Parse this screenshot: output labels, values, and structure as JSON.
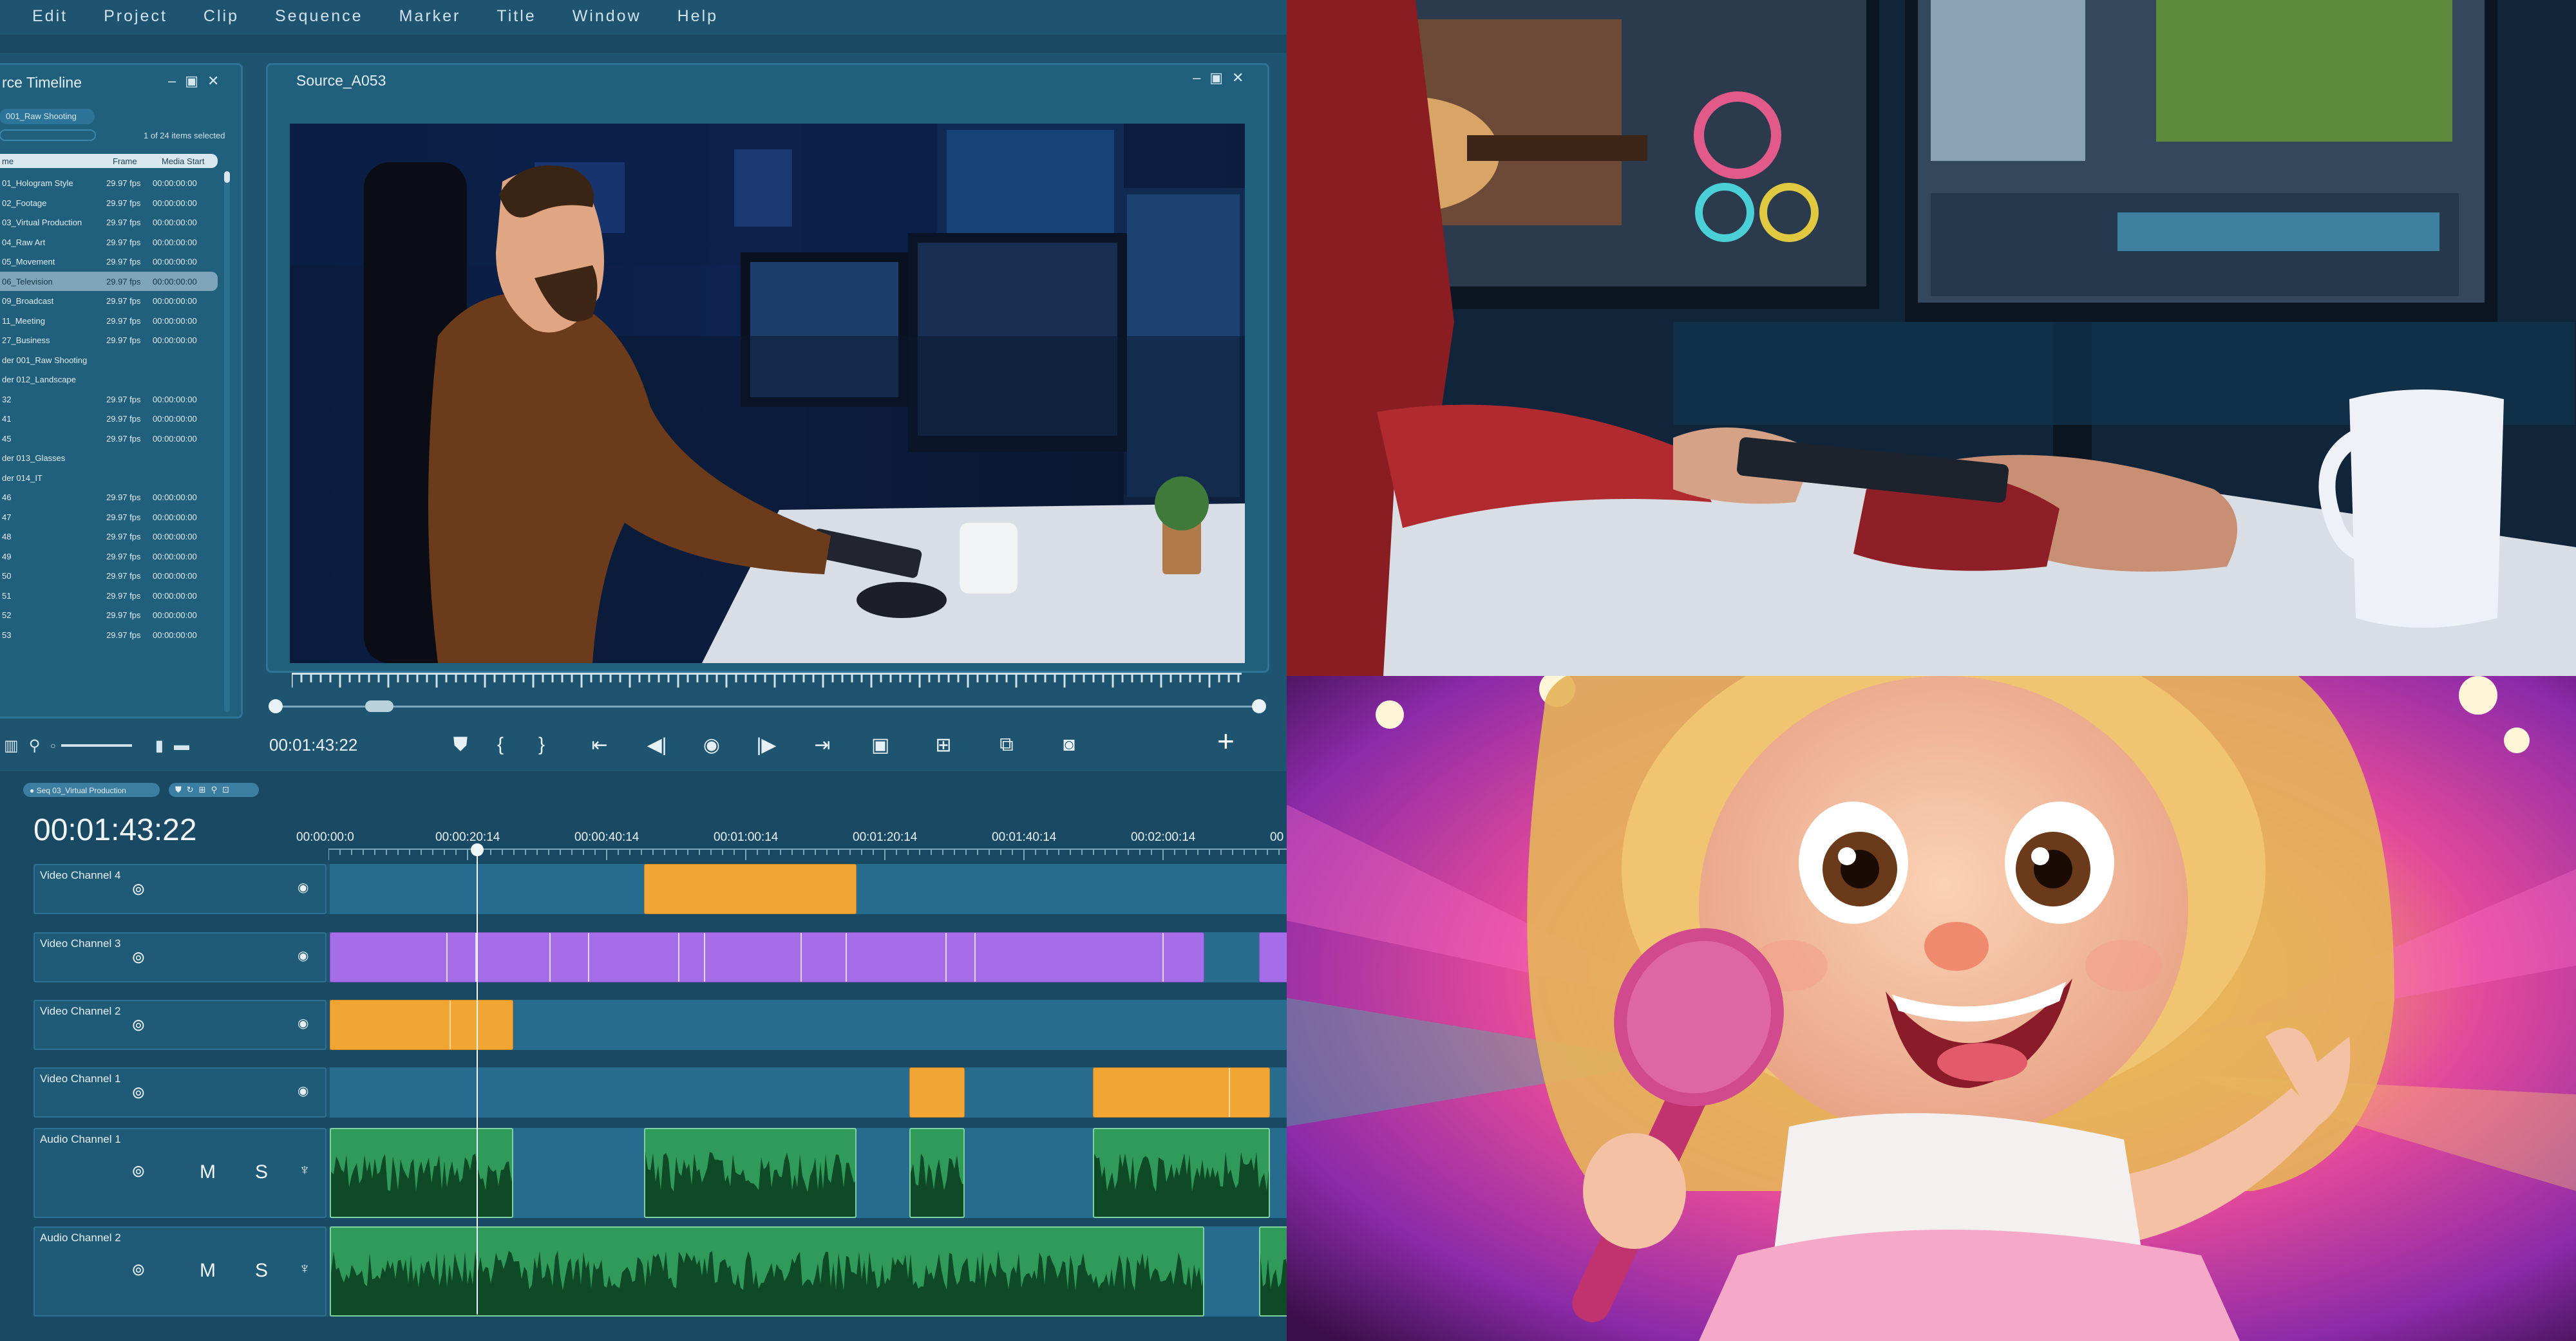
{
  "menu": [
    "Edit",
    "Project",
    "Clip",
    "Sequence",
    "Marker",
    "Title",
    "Window",
    "Help"
  ],
  "source_panel": {
    "title": "rce Timeline",
    "bin": "001_Raw Shooting",
    "selection": "1 of 24 items selected",
    "headers": {
      "name": "me",
      "frame": "Frame",
      "start": "Media Start"
    },
    "rows": [
      {
        "name": "01_Hologram Style",
        "fps": "29.97 fps",
        "start": "00:00:00:00",
        "sel": false
      },
      {
        "name": "02_Footage",
        "fps": "29.97 fps",
        "start": "00:00:00:00",
        "sel": false
      },
      {
        "name": "03_Virtual Production",
        "fps": "29.97 fps",
        "start": "00:00:00:00",
        "sel": false
      },
      {
        "name": "04_Raw Art",
        "fps": "29.97 fps",
        "start": "00:00:00:00",
        "sel": false
      },
      {
        "name": "05_Movement",
        "fps": "29.97 fps",
        "start": "00:00:00:00",
        "sel": false
      },
      {
        "name": "06_Television",
        "fps": "29.97 fps",
        "start": "00:00:00:00",
        "sel": true
      },
      {
        "name": "09_Broadcast",
        "fps": "29.97 fps",
        "start": "00:00:00:00",
        "sel": false
      },
      {
        "name": "11_Meeting",
        "fps": "29.97 fps",
        "start": "00:00:00:00",
        "sel": false
      },
      {
        "name": "27_Business",
        "fps": "29.97 fps",
        "start": "00:00:00:00",
        "sel": false
      },
      {
        "name": "der 001_Raw Shooting",
        "fps": "",
        "start": "",
        "sel": false
      },
      {
        "name": "der 012_Landscape",
        "fps": "",
        "start": "",
        "sel": false
      },
      {
        "name": "32",
        "fps": "29.97 fps",
        "start": "00:00:00:00",
        "sel": false
      },
      {
        "name": "41",
        "fps": "29.97 fps",
        "start": "00:00:00:00",
        "sel": false
      },
      {
        "name": "45",
        "fps": "29.97 fps",
        "start": "00:00:00:00",
        "sel": false
      },
      {
        "name": "der 013_Glasses",
        "fps": "",
        "start": "",
        "sel": false
      },
      {
        "name": "der 014_IT",
        "fps": "",
        "start": "",
        "sel": false
      },
      {
        "name": "46",
        "fps": "29.97 fps",
        "start": "00:00:00:00",
        "sel": false
      },
      {
        "name": "47",
        "fps": "29.97 fps",
        "start": "00:00:00:00",
        "sel": false
      },
      {
        "name": "48",
        "fps": "29.97 fps",
        "start": "00:00:00:00",
        "sel": false
      },
      {
        "name": "49",
        "fps": "29.97 fps",
        "start": "00:00:00:00",
        "sel": false
      },
      {
        "name": "50",
        "fps": "29.97 fps",
        "start": "00:00:00:00",
        "sel": false
      },
      {
        "name": "51",
        "fps": "29.97 fps",
        "start": "00:00:00:00",
        "sel": false
      },
      {
        "name": "52",
        "fps": "29.97 fps",
        "start": "00:00:00:00",
        "sel": false
      },
      {
        "name": "53",
        "fps": "29.97 fps",
        "start": "00:00:00:00",
        "sel": false
      }
    ]
  },
  "monitor": {
    "title": "Source_A053",
    "timecode": "00:01:43:22"
  },
  "timeline": {
    "sequence": "Seq 03_Virtual Production",
    "timecode": "00:01:43:22",
    "ruler": [
      "00:00:00:0",
      "00:00:20:14",
      "00:00:40:14",
      "00:01:00:14",
      "00:01:20:14",
      "00:01:40:14",
      "00:02:00:14",
      "00"
    ],
    "tracks": {
      "v4": "Video Channel 4",
      "v3": "Video Channel 3",
      "v2": "Video Channel 2",
      "v1": "Video Channel 1",
      "a1": "Audio Channel 1",
      "a2": "Audio Channel 2"
    },
    "mute_label": "M",
    "solo_label": "S"
  },
  "colors": {
    "panel": "#21607d",
    "video_clip_orange": "#f0a534",
    "video_clip_purple": "#a56ee8",
    "audio_clip_green": "#2f9a5a"
  }
}
